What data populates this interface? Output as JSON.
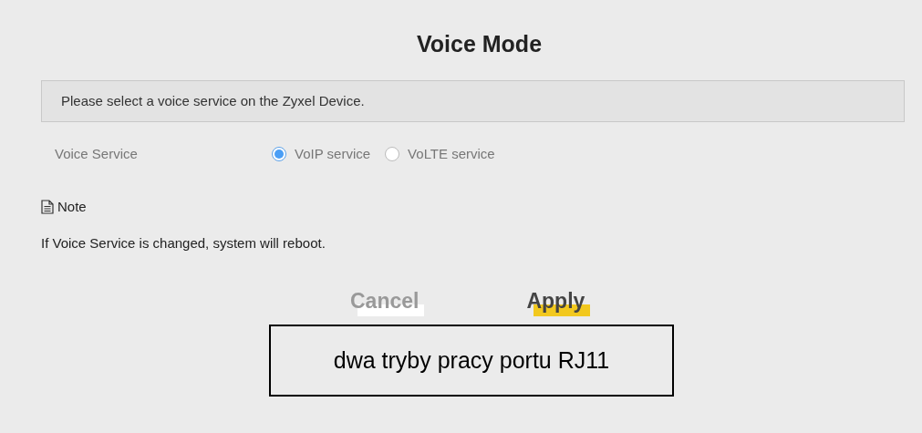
{
  "title": "Voice Mode",
  "info": "Please select a voice service on the Zyxel Device.",
  "voice_service": {
    "label": "Voice Service",
    "options": [
      {
        "label": "VoIP service",
        "selected": true
      },
      {
        "label": "VoLTE service",
        "selected": false
      }
    ]
  },
  "note": {
    "heading": "Note",
    "text": "If Voice Service is changed, system will reboot."
  },
  "buttons": [
    {
      "label": "Cancel",
      "kind": "secondary"
    },
    {
      "label": "Apply",
      "kind": "primary"
    }
  ],
  "caption": "dwa tryby pracy portu RJ11"
}
